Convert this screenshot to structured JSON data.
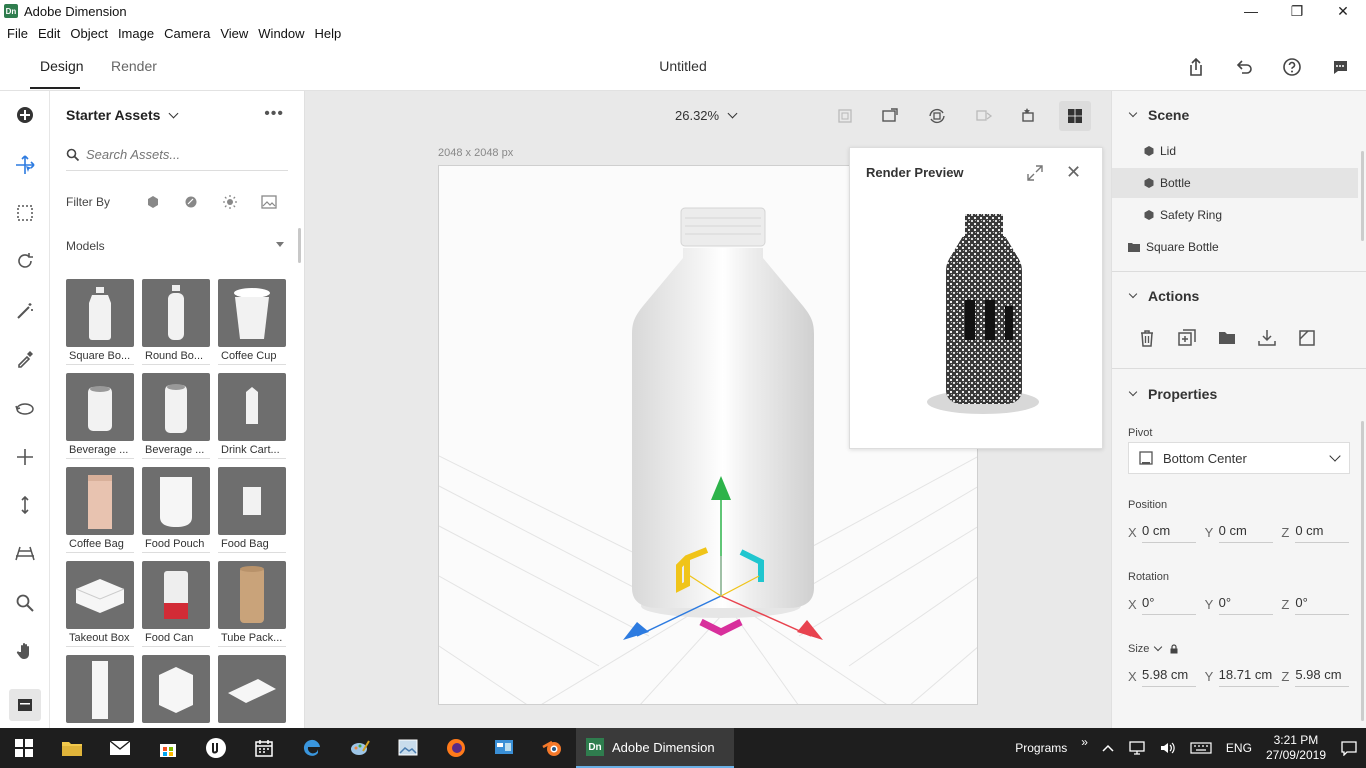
{
  "window": {
    "app_logo": "Dn",
    "title": "Adobe Dimension",
    "minimize": "—",
    "maximize": "❐",
    "close": "✕"
  },
  "menu": [
    "File",
    "Edit",
    "Object",
    "Image",
    "Camera",
    "View",
    "Window",
    "Help"
  ],
  "tabs": {
    "design": "Design",
    "render": "Render"
  },
  "document_title": "Untitled",
  "assets": {
    "header": "Starter Assets",
    "more": "•••",
    "search_placeholder": "Search Assets...",
    "filter_label": "Filter By",
    "section": "Models",
    "items": [
      {
        "label": "Square Bo..."
      },
      {
        "label": "Round Bo..."
      },
      {
        "label": "Coffee Cup"
      },
      {
        "label": "Beverage ..."
      },
      {
        "label": "Beverage ..."
      },
      {
        "label": "Drink Cart..."
      },
      {
        "label": "Coffee Bag"
      },
      {
        "label": "Food Pouch"
      },
      {
        "label": "Food Bag"
      },
      {
        "label": "Takeout Box"
      },
      {
        "label": "Food Can"
      },
      {
        "label": "Tube Pack..."
      },
      {
        "label": ""
      },
      {
        "label": ""
      },
      {
        "label": ""
      }
    ]
  },
  "viewport": {
    "zoom": "26.32%",
    "canvas_size": "2048 x 2048 px"
  },
  "render_preview": {
    "title": "Render Preview",
    "close": "✕"
  },
  "scene": {
    "title": "Scene",
    "items": [
      {
        "label": "Lid"
      },
      {
        "label": "Bottle"
      },
      {
        "label": "Safety Ring"
      },
      {
        "label": "Square Bottle"
      }
    ]
  },
  "actions": {
    "title": "Actions"
  },
  "properties": {
    "title": "Properties",
    "pivot_label": "Pivot",
    "pivot_value": "Bottom Center",
    "position_label": "Position",
    "position": {
      "x": "0 cm",
      "y": "0 cm",
      "z": "0 cm"
    },
    "rotation_label": "Rotation",
    "rotation": {
      "x": "0°",
      "y": "0°",
      "z": "0°"
    },
    "size_label": "Size",
    "size": {
      "x": "5.98 cm",
      "y": "18.71 cm",
      "z": "5.98 cm"
    },
    "axis": {
      "x": "X",
      "y": "Y",
      "z": "Z"
    }
  },
  "taskbar": {
    "active_logo": "Dn",
    "active_app": "Adobe Dimension",
    "programs": "Programs",
    "programs_arrow": "»",
    "lang": "ENG",
    "time": "3:21 PM",
    "date": "27/09/2019"
  },
  "colors": {
    "accent_green": "#2f7d4e",
    "gizmo_y": "#2db34a",
    "gizmo_x": "#e8434f",
    "gizmo_z": "#2d7be0",
    "gizmo_plane": "#d82f9c"
  }
}
